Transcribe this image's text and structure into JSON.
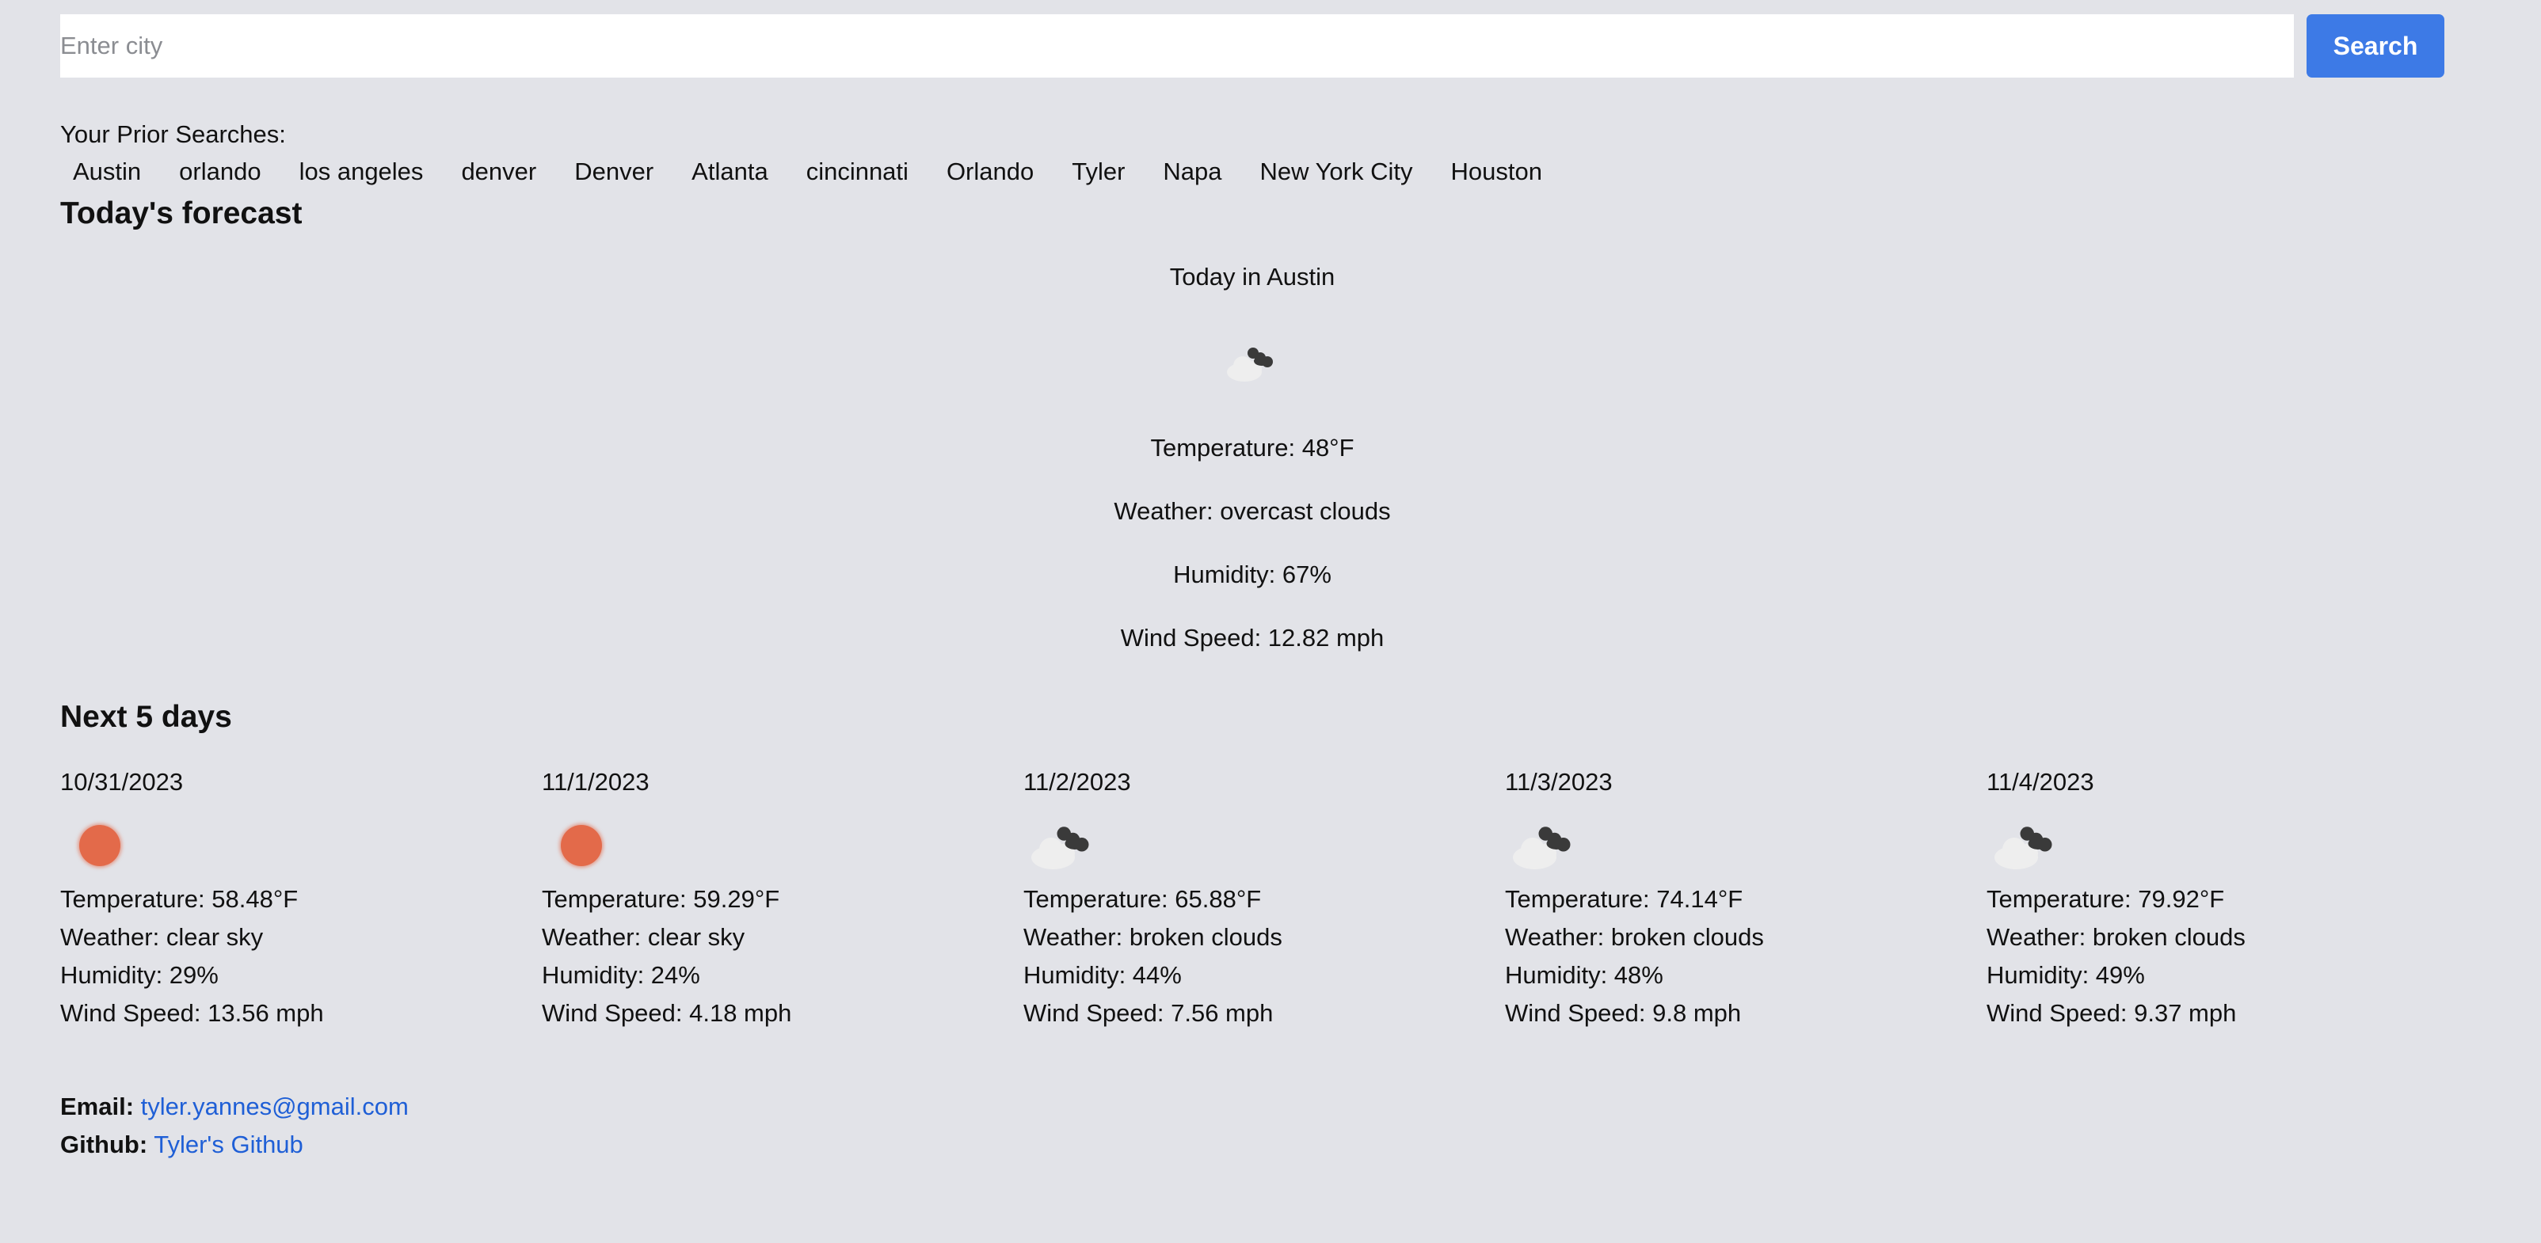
{
  "search": {
    "placeholder": "Enter city",
    "value": "",
    "button_label": "Search"
  },
  "prior_searches": {
    "label": "Your Prior Searches:",
    "items": [
      "Austin",
      "orlando",
      "los angeles",
      "denver",
      "Denver",
      "Atlanta",
      "cincinnati",
      "Orlando",
      "Tyler",
      "Napa",
      "New York City",
      "Houston"
    ]
  },
  "today": {
    "heading": "Today's forecast",
    "title": "Today in Austin",
    "icon": "broken-clouds-icon",
    "temperature": "Temperature: 48°F",
    "weather": "Weather: overcast clouds",
    "humidity": "Humidity: 67%",
    "wind": "Wind Speed: 12.82 mph"
  },
  "forecast": {
    "heading": "Next 5 days",
    "days": [
      {
        "date": "10/31/2023",
        "icon": "clear-sky-icon",
        "temperature": "Temperature: 58.48°F",
        "weather": "Weather: clear sky",
        "humidity": "Humidity: 29%",
        "wind": "Wind Speed: 13.56 mph"
      },
      {
        "date": "11/1/2023",
        "icon": "clear-sky-icon",
        "temperature": "Temperature: 59.29°F",
        "weather": "Weather: clear sky",
        "humidity": "Humidity: 24%",
        "wind": "Wind Speed: 4.18 mph"
      },
      {
        "date": "11/2/2023",
        "icon": "broken-clouds-icon",
        "temperature": "Temperature: 65.88°F",
        "weather": "Weather: broken clouds",
        "humidity": "Humidity: 44%",
        "wind": "Wind Speed: 7.56 mph"
      },
      {
        "date": "11/3/2023",
        "icon": "broken-clouds-icon",
        "temperature": "Temperature: 74.14°F",
        "weather": "Weather: broken clouds",
        "humidity": "Humidity: 48%",
        "wind": "Wind Speed: 9.8 mph"
      },
      {
        "date": "11/4/2023",
        "icon": "broken-clouds-icon",
        "temperature": "Temperature: 79.92°F",
        "weather": "Weather: broken clouds",
        "humidity": "Humidity: 49%",
        "wind": "Wind Speed: 9.37 mph"
      }
    ]
  },
  "footer": {
    "email_label": "Email:",
    "email": "tyler.yannes@gmail.com",
    "github_label": "Github:",
    "github_link": "Tyler's Github"
  },
  "colors": {
    "background": "#e2e3e8",
    "accent": "#3d7ae6",
    "link": "#1f5fd6",
    "sun": "#e36a4a"
  }
}
